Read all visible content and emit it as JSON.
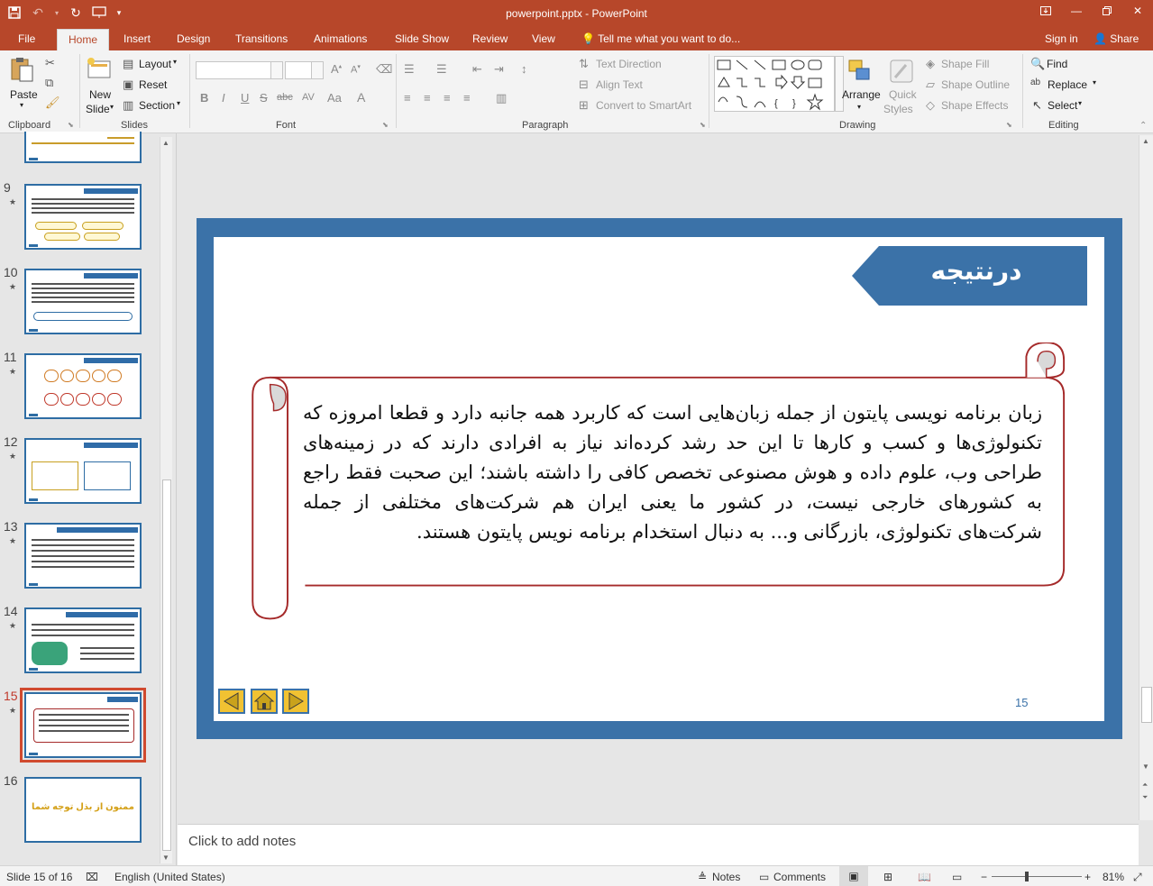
{
  "titlebar": {
    "title": "powerpoint.pptx - PowerPoint"
  },
  "tabs": {
    "file": "File",
    "home": "Home",
    "insert": "Insert",
    "design": "Design",
    "transitions": "Transitions",
    "animations": "Animations",
    "slideshow": "Slide Show",
    "review": "Review",
    "view": "View",
    "tellme": "Tell me what you want to do...",
    "signin": "Sign in",
    "share": "Share"
  },
  "ribbon": {
    "clipboard": {
      "paste": "Paste",
      "label": "Clipboard"
    },
    "slides": {
      "new_slide_1": "New",
      "new_slide_2": "Slide",
      "layout": "Layout",
      "reset": "Reset",
      "section": "Section",
      "label": "Slides"
    },
    "font": {
      "bold": "B",
      "italic": "I",
      "underline": "U",
      "strike": "S",
      "abc": "abc",
      "spacing": "AV",
      "case": "Aa",
      "label": "Font"
    },
    "paragraph": {
      "text_direction": "Text Direction",
      "align_text": "Align Text",
      "smartart": "Convert to SmartArt",
      "label": "Paragraph"
    },
    "drawing": {
      "arrange": "Arrange",
      "quick_styles_1": "Quick",
      "quick_styles_2": "Styles",
      "shape_fill": "Shape Fill",
      "shape_outline": "Shape Outline",
      "shape_effects": "Shape Effects",
      "label": "Drawing"
    },
    "editing": {
      "find": "Find",
      "replace": "Replace",
      "select": "Select",
      "label": "Editing"
    }
  },
  "thumbnails": [
    {
      "num": "",
      "text": ""
    },
    {
      "num": "9",
      "text": ""
    },
    {
      "num": "10",
      "text": ""
    },
    {
      "num": "11",
      "text": ""
    },
    {
      "num": "12",
      "text": ""
    },
    {
      "num": "13",
      "text": ""
    },
    {
      "num": "14",
      "text": ""
    },
    {
      "num": "15",
      "text": ""
    },
    {
      "num": "16",
      "text": "ممنون از بذل توجه شما"
    }
  ],
  "slide": {
    "title": "درنتیجه",
    "body": "زبان برنامه نویسی پایتون از جمله زبان‌هایی است که کاربرد همه جانبه دارد و قطعا امروزه که تکنولوژی‌ها و کسب و کارها تا این حد رشد کرده‌اند نیاز به افرادی دارند که در زمینه‌های طراحی وب، علوم داده و هوش مصنوعی تخصص کافی را داشته باشند؛ این صحبت فقط راجع به کشورهای خارجی نیست، در کشور ما یعنی ایران هم شرکت‌های مختلفی از جمله شرکت‌های تکنولوژی، بازرگانی و... به دنبال استخدام برنامه نویس پایتون هستند.",
    "number": "15"
  },
  "notes": {
    "placeholder": "Click to add notes"
  },
  "status": {
    "slide_of": "Slide 15 of 16",
    "language": "English (United States)",
    "notes": "Notes",
    "comments": "Comments",
    "zoom": "81%"
  }
}
